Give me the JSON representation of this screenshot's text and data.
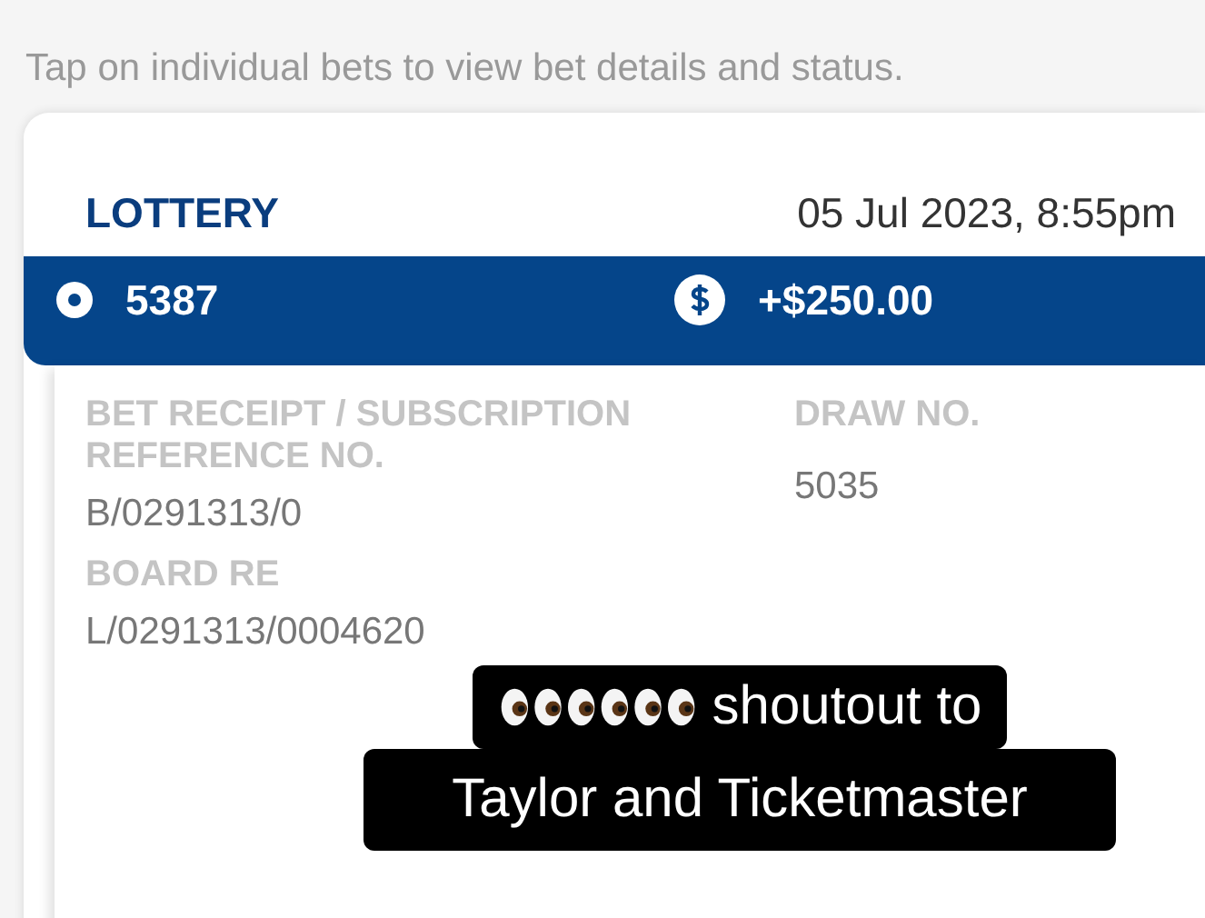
{
  "intro": "Tap on individual bets to view bet details and status.",
  "card": {
    "type": "LOTTERY",
    "date": "05 Jul 2023, 8:55pm",
    "bet_number": "5387",
    "amount": "+$250.00",
    "details": [
      {
        "label": "BET RECEIPT / SUBSCRIPTION REFERENCE NO.",
        "value": "B/0291313/0"
      },
      {
        "label": "DRAW NO.",
        "value": "5035"
      },
      {
        "label": "BOARD RE",
        "value": "L/0291313/0004620"
      }
    ]
  },
  "caption": {
    "lines": [
      "shoutout to",
      "Taylor and Ticketmaster"
    ]
  }
}
